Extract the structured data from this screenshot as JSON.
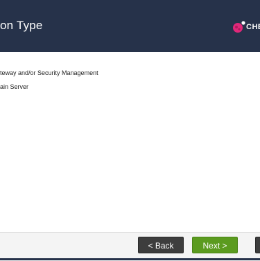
{
  "header": {
    "title": "on Type",
    "logo_text": "CHE"
  },
  "options": [
    {
      "label": "teway and/or Security Management"
    },
    {
      "label": "ain Server"
    }
  ],
  "buttons": {
    "back": "< Back",
    "next": "Next >"
  },
  "colors": {
    "header_bg": "#26324a",
    "next_bg": "#5b9b1f",
    "back_bg": "#3d3d3d",
    "logo_accent": "#e0287a"
  }
}
